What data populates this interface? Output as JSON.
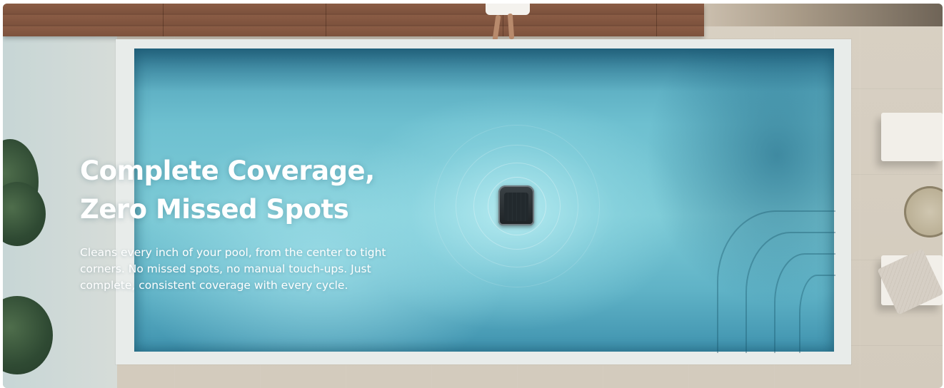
{
  "hero": {
    "headline_line1": "Complete Coverage,",
    "headline_line2": "Zero Missed Spots",
    "description": "Cleans every inch of your pool, from the center to tight corners. No missed spots, no manual touch-ups. Just complete, consistent coverage with every cycle.",
    "text_color": "#ffffff"
  },
  "scene": {
    "icons": [
      "pool-cleaning-robot-icon"
    ],
    "water_color": "#6ec0d0",
    "deck_color": "#8a5c45",
    "patio_color": "#d6cfc3"
  }
}
